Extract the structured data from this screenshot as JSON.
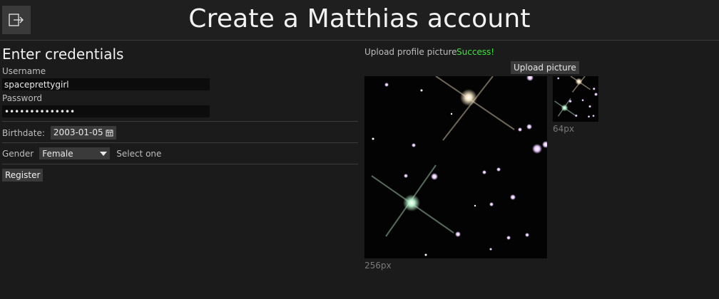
{
  "header": {
    "title": "Create a Matthias account",
    "logout_icon": "logout-icon"
  },
  "credentials": {
    "heading": "Enter credentials",
    "username_label": "Username",
    "username_value": "spaceprettygirl",
    "password_label": "Password",
    "password_value": "••••••••••••••"
  },
  "birthdate": {
    "label": "Birthdate:",
    "value": "2003-01-05",
    "icon": "calendar-icon"
  },
  "gender": {
    "label": "Gender",
    "selected": "Female",
    "hint": "Select one"
  },
  "register": {
    "label": "Register"
  },
  "upload": {
    "label": "Upload profile picture",
    "status": "Success!",
    "status_color": "#3fe33f",
    "button_label": "Upload picture"
  },
  "preview": {
    "large_label": "256px",
    "small_label": "64px"
  }
}
